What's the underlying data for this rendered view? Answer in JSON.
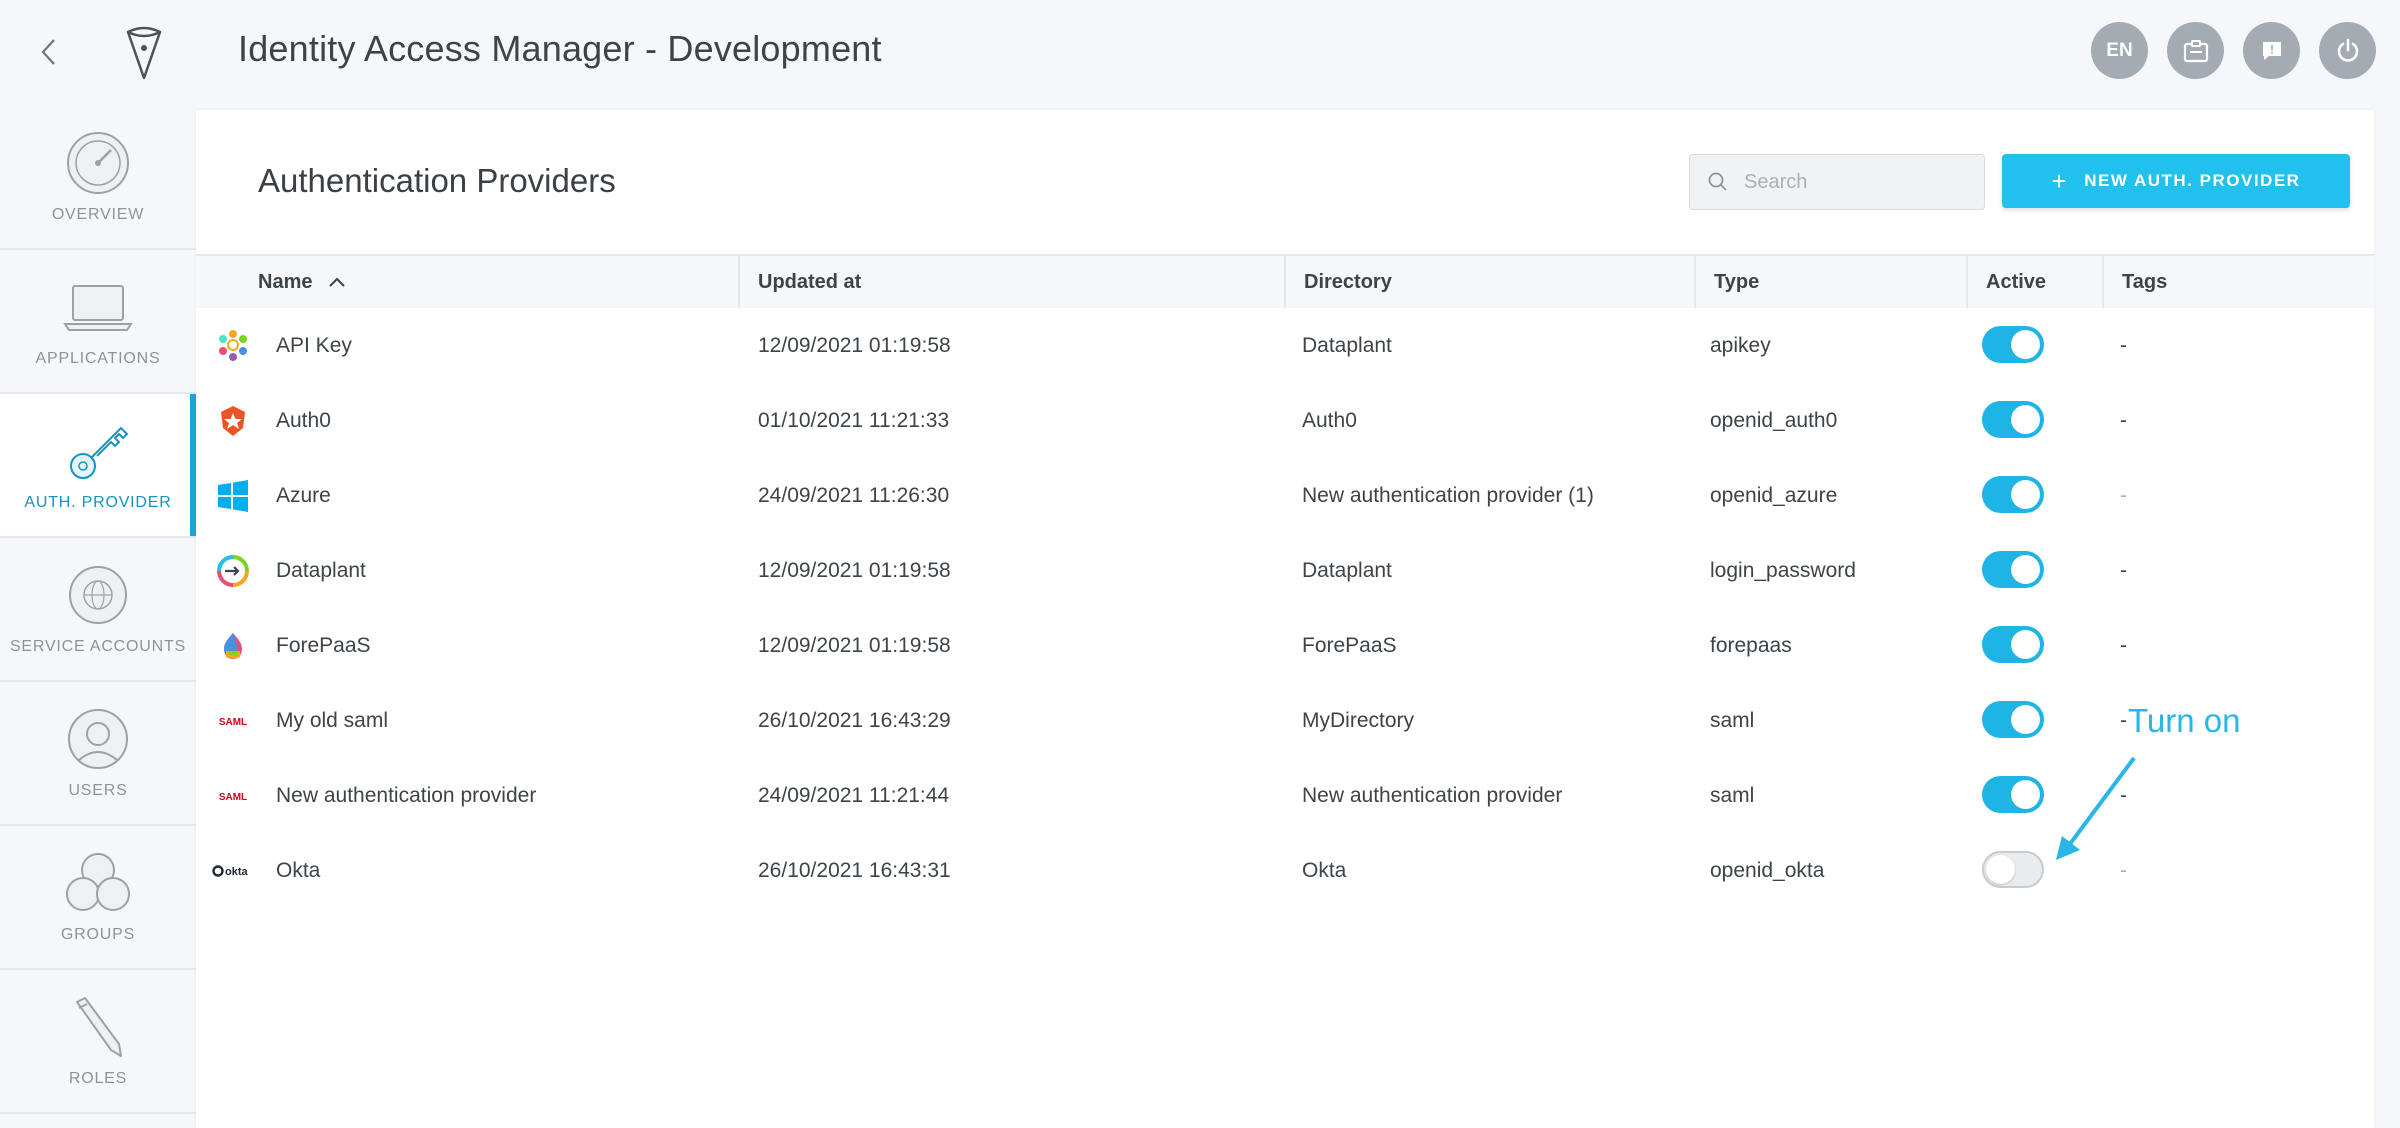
{
  "header": {
    "title": "Identity Access Manager - Development",
    "lang_button": "EN",
    "icons": [
      "back-chevron-icon",
      "logo-icon",
      "clipboard-icon",
      "help-icon",
      "power-icon"
    ]
  },
  "sidebar": {
    "items": [
      {
        "label": "OVERVIEW",
        "icon": "gauge-icon",
        "active": false
      },
      {
        "label": "APPLICATIONS",
        "icon": "laptop-icon",
        "active": false
      },
      {
        "label": "AUTH. PROVIDER",
        "icon": "key-icon",
        "active": true
      },
      {
        "label": "SERVICE ACCOUNTS",
        "icon": "gear-globe-icon",
        "active": false
      },
      {
        "label": "USERS",
        "icon": "user-icon",
        "active": false
      },
      {
        "label": "GROUPS",
        "icon": "group-icon",
        "active": false
      },
      {
        "label": "ROLES",
        "icon": "pencil-icon",
        "active": false
      }
    ]
  },
  "main": {
    "title": "Authentication Providers",
    "search_placeholder": "Search",
    "new_button_label": "NEW AUTH. PROVIDER",
    "columns": {
      "name": "Name",
      "updated_at": "Updated at",
      "directory": "Directory",
      "type": "Type",
      "active": "Active",
      "tags": "Tags"
    },
    "rows": [
      {
        "name": "API Key",
        "updated_at": "12/09/2021 01:19:58",
        "directory": "Dataplant",
        "type": "apikey",
        "active": true,
        "tags": "-",
        "icon": "apikey-icon"
      },
      {
        "name": "Auth0",
        "updated_at": "01/10/2021 11:21:33",
        "directory": "Auth0",
        "type": "openid_auth0",
        "active": true,
        "tags": "-",
        "icon": "auth0-icon"
      },
      {
        "name": "Azure",
        "updated_at": "24/09/2021 11:26:30",
        "directory": "New authentication provider (1)",
        "type": "openid_azure",
        "active": true,
        "tags": "-",
        "icon": "windows-icon"
      },
      {
        "name": "Dataplant",
        "updated_at": "12/09/2021 01:19:58",
        "directory": "Dataplant",
        "type": "login_password",
        "active": true,
        "tags": "-",
        "icon": "dataplant-icon"
      },
      {
        "name": "ForePaaS",
        "updated_at": "12/09/2021 01:19:58",
        "directory": "ForePaaS",
        "type": "forepaas",
        "active": true,
        "tags": "-",
        "icon": "forepaas-icon"
      },
      {
        "name": "My old saml",
        "updated_at": "26/10/2021 16:43:29",
        "directory": "MyDirectory",
        "type": "saml",
        "active": true,
        "tags": "-",
        "icon": "saml-icon"
      },
      {
        "name": "New authentication provider",
        "updated_at": "24/09/2021 11:21:44",
        "directory": "New authentication provider",
        "type": "saml",
        "active": true,
        "tags": "-",
        "icon": "saml-icon"
      },
      {
        "name": "Okta",
        "updated_at": "26/10/2021 16:43:31",
        "directory": "Okta",
        "type": "openid_okta",
        "active": false,
        "tags": "-",
        "icon": "okta-icon"
      }
    ],
    "saml_logo_text": "SAML",
    "okta_logo_text": "okta"
  },
  "annotation": {
    "text": "Turn on",
    "color": "#28b6e8"
  },
  "colors": {
    "accent": "#22c1ed",
    "toggle_on": "#1fb4e6",
    "active_nav": "#1593c2"
  }
}
